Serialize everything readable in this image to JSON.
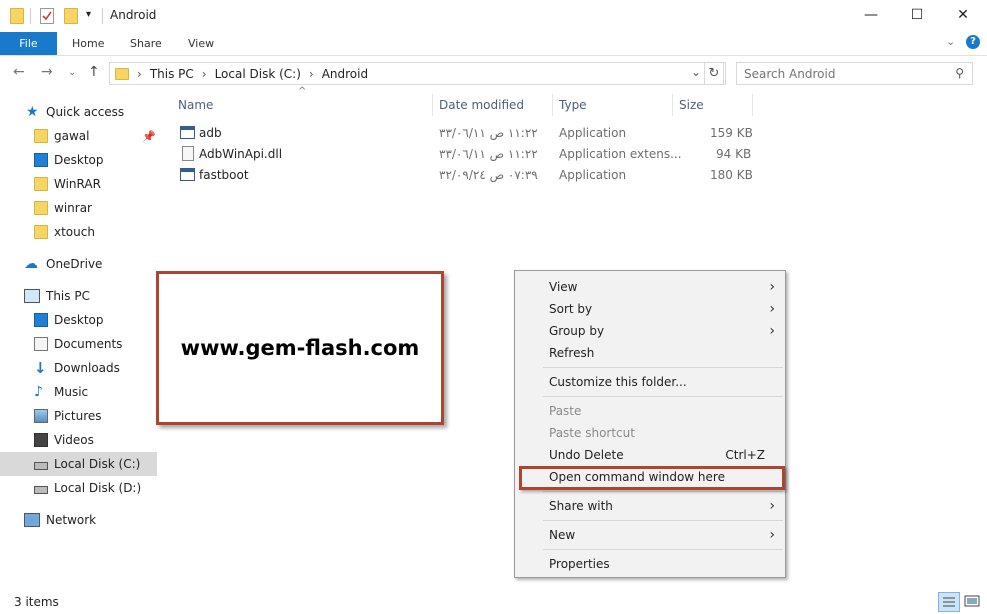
{
  "window": {
    "title": "Android",
    "controls": {
      "minimize": "—",
      "maximize": "☐",
      "close": "✕"
    }
  },
  "ribbon": {
    "tabs": [
      "File",
      "Home",
      "Share",
      "View"
    ]
  },
  "address": {
    "crumbs": [
      "This PC",
      "Local Disk (C:)",
      "Android"
    ]
  },
  "search": {
    "placeholder": "Search Android"
  },
  "sidebar": {
    "items": [
      {
        "label": "Quick access",
        "icon": "star-icon"
      },
      {
        "label": "gawal",
        "icon": "folder-icon"
      },
      {
        "label": "Desktop",
        "icon": "desktop-icon"
      },
      {
        "label": "WinRAR",
        "icon": "folder-icon"
      },
      {
        "label": "winrar",
        "icon": "folder-icon"
      },
      {
        "label": "xtouch",
        "icon": "folder-icon"
      },
      {
        "label": "OneDrive",
        "icon": "cloud-icon"
      },
      {
        "label": "This PC",
        "icon": "computer-icon"
      },
      {
        "label": "Desktop",
        "icon": "desktop-icon"
      },
      {
        "label": "Documents",
        "icon": "documents-icon"
      },
      {
        "label": "Downloads",
        "icon": "downloads-icon"
      },
      {
        "label": "Music",
        "icon": "music-icon"
      },
      {
        "label": "Pictures",
        "icon": "pictures-icon"
      },
      {
        "label": "Videos",
        "icon": "videos-icon"
      },
      {
        "label": "Local Disk (C:)",
        "icon": "drive-icon"
      },
      {
        "label": "Local Disk (D:)",
        "icon": "drive-icon"
      },
      {
        "label": "Network",
        "icon": "network-icon"
      }
    ]
  },
  "filelist": {
    "columns": [
      "Name",
      "Date modified",
      "Type",
      "Size"
    ],
    "rows": [
      {
        "name": "adb",
        "date": "١١:٢٢ ص ٣٣/٠٦/١١",
        "type": "Application",
        "size": "159 KB",
        "icon": "app-icon"
      },
      {
        "name": "AdbWinApi.dll",
        "date": "١١:٢٢ ص ٣٣/٠٦/١١",
        "type": "Application extens...",
        "size": "94 KB",
        "icon": "dll-icon"
      },
      {
        "name": "fastboot",
        "date": "٠٧:٣٩ ص ٣٢/٠٩/٢٤",
        "type": "Application",
        "size": "180 KB",
        "icon": "app-icon"
      }
    ]
  },
  "watermark": {
    "text": "www.gem-flash.com"
  },
  "context_menu": {
    "view": "View",
    "sort_by": "Sort by",
    "group_by": "Group by",
    "refresh": "Refresh",
    "customize": "Customize this folder...",
    "paste": "Paste",
    "paste_shortcut": "Paste shortcut",
    "undo_delete": "Undo Delete",
    "undo_shortcut": "Ctrl+Z",
    "open_cmd": "Open command window here",
    "share_with": "Share with",
    "new": "New",
    "properties": "Properties"
  },
  "status": {
    "item_count": "3 items"
  },
  "colors": {
    "accent": "#1979ca",
    "highlight_box": "#b0452f"
  }
}
